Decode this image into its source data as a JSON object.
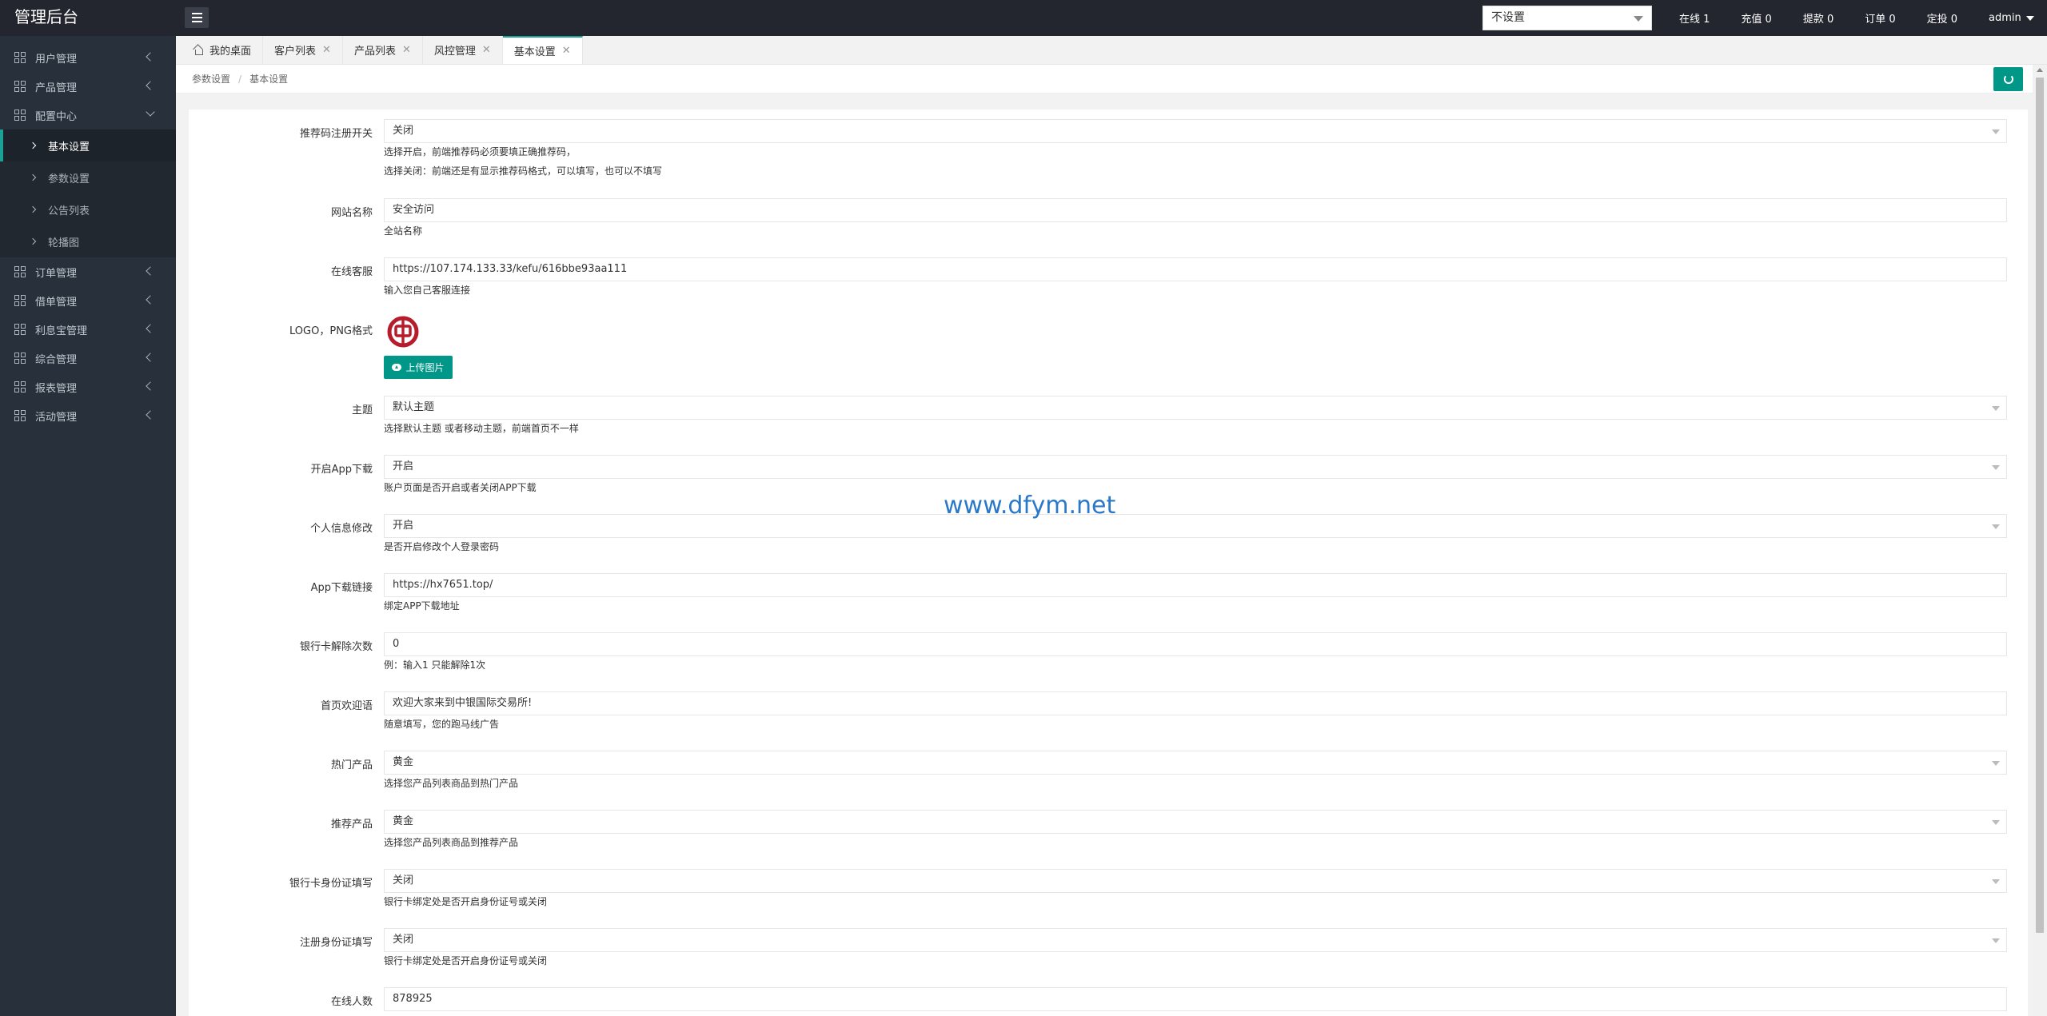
{
  "app": {
    "title": "管理后台"
  },
  "header": {
    "select_value": "不设置",
    "stats": [
      "在线 1",
      "充值 0",
      "提款 0",
      "订单 0",
      "定投 0"
    ],
    "user": "admin"
  },
  "sidebar": {
    "items": [
      {
        "label": "用户管理"
      },
      {
        "label": "产品管理"
      },
      {
        "label": "配置中心"
      },
      {
        "label": "订单管理"
      },
      {
        "label": "借单管理"
      },
      {
        "label": "利息宝管理"
      },
      {
        "label": "综合管理"
      },
      {
        "label": "报表管理"
      },
      {
        "label": "活动管理"
      }
    ],
    "subitems": [
      {
        "label": "基本设置"
      },
      {
        "label": "参数设置"
      },
      {
        "label": "公告列表"
      },
      {
        "label": "轮播图"
      }
    ]
  },
  "tabs": [
    {
      "label": "我的桌面"
    },
    {
      "label": "客户列表"
    },
    {
      "label": "产品列表"
    },
    {
      "label": "风控管理"
    },
    {
      "label": "基本设置"
    }
  ],
  "breadcrumb": [
    "参数设置",
    "基本设置"
  ],
  "form": {
    "referral": {
      "label": "推荐码注册开关",
      "value": "关闭",
      "help1": "选择开启，前端推荐码必须要填正确推荐码，",
      "help2": "选择关闭：前端还是有显示推荐码格式，可以填写，也可以不填写"
    },
    "site_name": {
      "label": "网站名称",
      "value": "安全访问",
      "help": "全站名称"
    },
    "service": {
      "label": "在线客服",
      "value": "https://107.174.133.33/kefu/616bbe93aa111",
      "help": "输入您自己客服连接"
    },
    "logo": {
      "label": "LOGO，PNG格式",
      "upload": "上传图片"
    },
    "theme": {
      "label": "主题",
      "value": "默认主题",
      "help": "选择默认主题 或者移动主题，前端首页不一样"
    },
    "app_download": {
      "label": "开启App下载",
      "value": "开启",
      "help": "账户页面是否开启或者关闭APP下载"
    },
    "profile_edit": {
      "label": "个人信息修改",
      "value": "开启",
      "help": "是否开启修改个人登录密码"
    },
    "app_link": {
      "label": "App下载链接",
      "value": "https://hx7651.top/",
      "help": "绑定APP下载地址"
    },
    "unbind": {
      "label": "银行卡解除次数",
      "value": "0",
      "help": "例：输入1 只能解除1次"
    },
    "welcome": {
      "label": "首页欢迎语",
      "value": "欢迎大家来到中银国际交易所!",
      "help": "随意填写，您的跑马线广告"
    },
    "hot": {
      "label": "热门产品",
      "value": "黄金",
      "help": "选择您产品列表商品到热门产品"
    },
    "recommend": {
      "label": "推荐产品",
      "value": "黄金",
      "help": "选择您产品列表商品到推荐产品"
    },
    "bank_id": {
      "label": "银行卡身份证填写",
      "value": "关闭",
      "help": "银行卡绑定处是否开启身份证号或关闭"
    },
    "reg_id": {
      "label": "注册身份证填写",
      "value": "关闭",
      "help": "银行卡绑定处是否开启身份证号或关闭"
    },
    "online": {
      "label": "在线人数",
      "value": "878925"
    }
  },
  "watermark": "www.dfym.net",
  "colors": {
    "accent": "#009688",
    "header": "#23262e",
    "sidebar": "#27303b"
  }
}
